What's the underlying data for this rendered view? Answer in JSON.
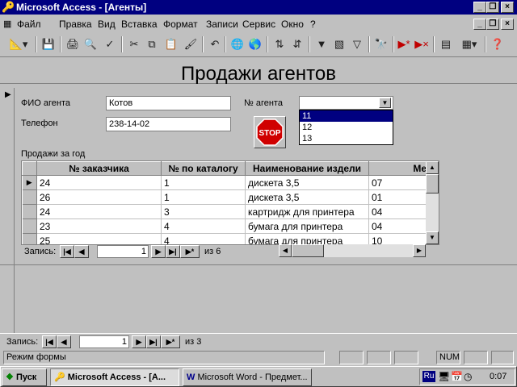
{
  "window": {
    "title": "Microsoft Access - [Агенты]"
  },
  "menu": {
    "items": [
      "Файл",
      "Правка",
      "Вид",
      "Вставка",
      "Формат",
      "Записи",
      "Сервис",
      "Окно",
      "?"
    ]
  },
  "form": {
    "title": "Продажи агентов",
    "fio_label": "ФИО агента",
    "fio_value": "Котов",
    "phone_label": "Телефон",
    "phone_value": "238-14-02",
    "agent_no_label": "№ агента",
    "agent_no_value": "",
    "agent_options": [
      "11",
      "12",
      "13"
    ],
    "stop_label": "STOP",
    "subform_label": "Продажи за год"
  },
  "subform": {
    "columns": [
      "№ заказчика",
      "№ по каталогу",
      "Наименование издели",
      "Ме"
    ],
    "rows": [
      [
        "24",
        "1",
        "дискета  3,5",
        "07"
      ],
      [
        "26",
        "1",
        "дискета  3,5",
        "01"
      ],
      [
        "24",
        "3",
        "картридж для принтера",
        "04"
      ],
      [
        "23",
        "4",
        "бумага для принтера",
        "04"
      ],
      [
        "25",
        "4",
        "бумага для принтера",
        "10"
      ]
    ],
    "nav_label": "Запись:",
    "nav_current": "1",
    "nav_of": "из  6"
  },
  "main_nav": {
    "label": "Запись:",
    "current": "1",
    "of": "из  3"
  },
  "status": {
    "text": "Режим формы",
    "num": "NUM"
  },
  "taskbar": {
    "start": "Пуск",
    "task1": "Microsoft Access - [А...",
    "task2": "Microsoft Word - Предмет...",
    "lang": "Ru",
    "time": "0:07"
  }
}
